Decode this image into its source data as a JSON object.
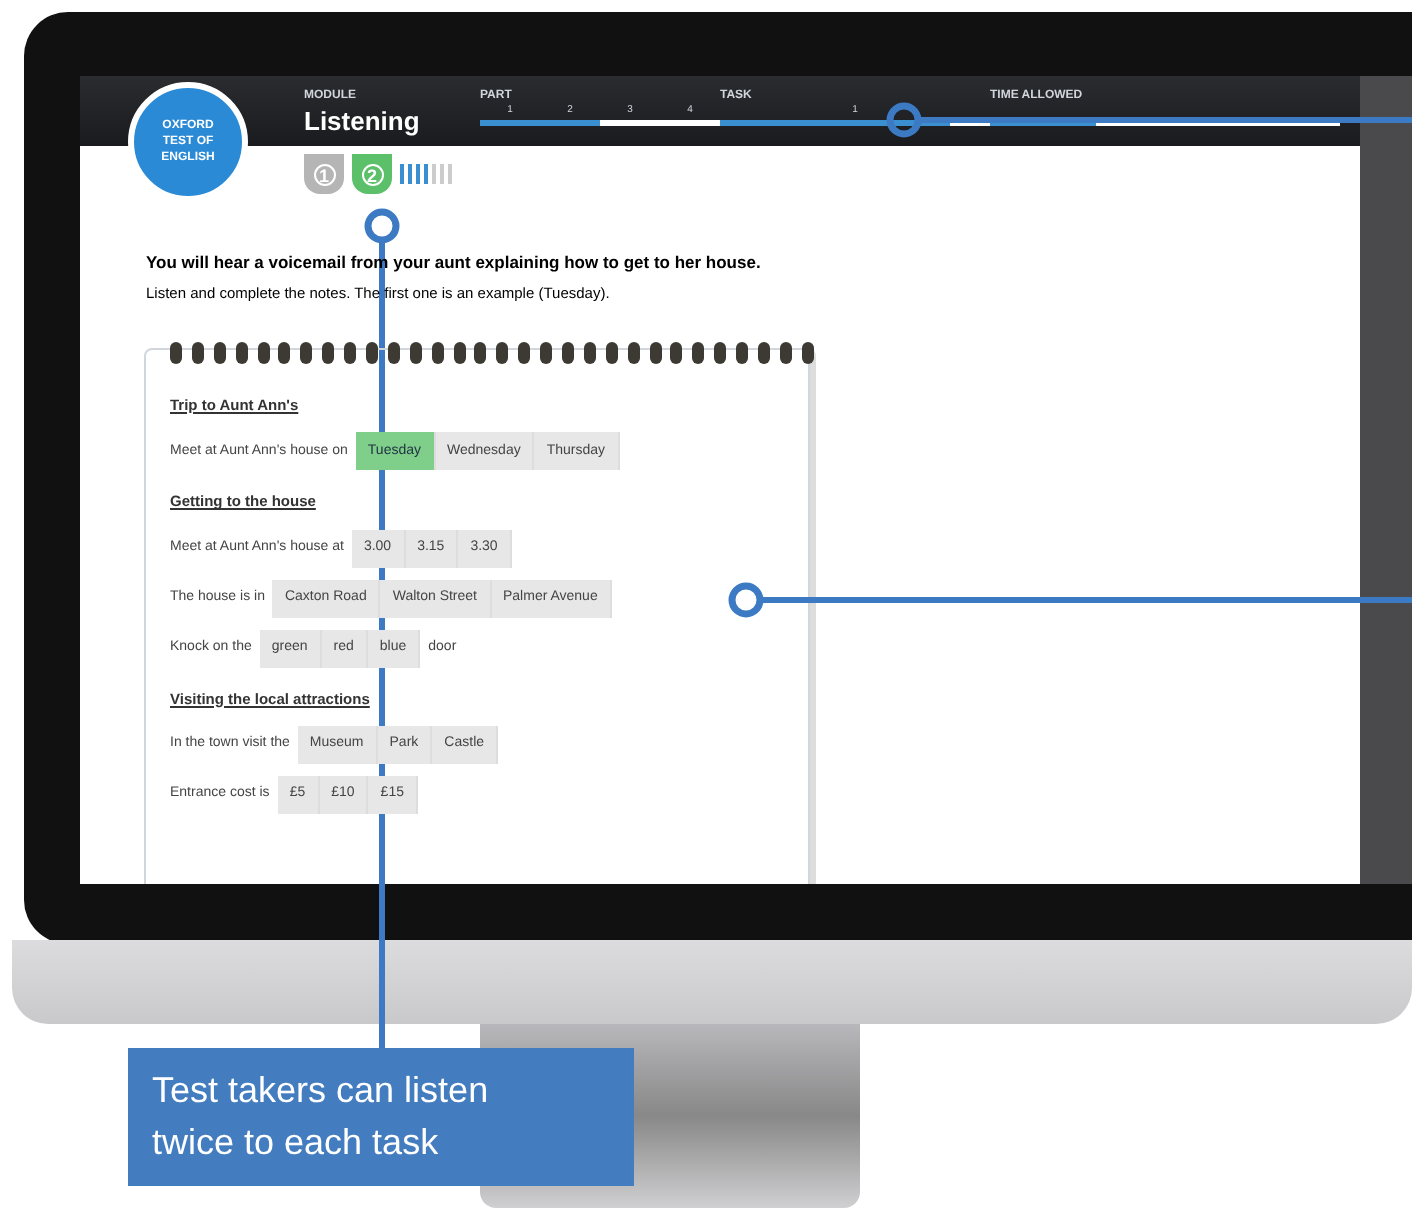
{
  "header": {
    "module_label": "MODULE",
    "module": "Listening",
    "part_label": "PART",
    "parts": [
      "1",
      "2",
      "3",
      "4"
    ],
    "part_progress": {
      "level": 0.5
    },
    "task_label": "TASK",
    "tasks": [
      "1"
    ],
    "task_progress": {
      "level": 0.85
    },
    "time_label": "TIME ALLOWED",
    "time_progress": {
      "level": 0.3
    }
  },
  "logo": {
    "lines": [
      "OXFORD",
      "TEST OF",
      "ENGLISH"
    ]
  },
  "plays": [
    {
      "label": "1",
      "active": false
    },
    {
      "label": "2",
      "active": true
    }
  ],
  "volume": {
    "level": 0.57
  },
  "instructions": {
    "title": "You will hear a voicemail from your aunt explaining how to get to her house.",
    "text": "Listen and complete the notes. The first one is an example (Tuesday)."
  },
  "sections": [
    {
      "heading": "Trip to Aunt Ann's",
      "rows": [
        {
          "before": "Meet at Aunt Ann's house on",
          "options": [
            {
              "label": "Tuesday",
              "selected": true
            },
            {
              "label": "Wednesday",
              "selected": false
            },
            {
              "label": "Thursday",
              "selected": false
            }
          ]
        }
      ]
    },
    {
      "heading": "Getting to the house",
      "rows": [
        {
          "before": "Meet at Aunt Ann's house at",
          "options": [
            {
              "label": "3.00",
              "selected": false
            },
            {
              "label": "3.15",
              "selected": false
            },
            {
              "label": "3.30",
              "selected": false
            }
          ]
        },
        {
          "before": "The house is in",
          "options": [
            {
              "label": "Caxton Road",
              "selected": false
            },
            {
              "label": "Walton Street",
              "selected": false
            },
            {
              "label": "Palmer Avenue",
              "selected": false
            }
          ]
        },
        {
          "before": "Knock on the",
          "options": [
            {
              "label": "green",
              "selected": false
            },
            {
              "label": "red",
              "selected": false
            },
            {
              "label": "blue",
              "selected": false
            }
          ],
          "after": "door"
        }
      ]
    },
    {
      "heading": "Visiting the local attractions",
      "rows": [
        {
          "before": "In the town visit the",
          "options": [
            {
              "label": "Museum",
              "selected": false
            },
            {
              "label": "Park",
              "selected": false
            },
            {
              "label": "Castle",
              "selected": false
            }
          ]
        },
        {
          "before": "Entrance cost is",
          "options": [
            {
              "label": "£5",
              "selected": false
            },
            {
              "label": "£10",
              "selected": false
            },
            {
              "label": "£15",
              "selected": false
            }
          ]
        }
      ]
    }
  ],
  "callout": {
    "text": "Test takers can listen twice to each task"
  }
}
